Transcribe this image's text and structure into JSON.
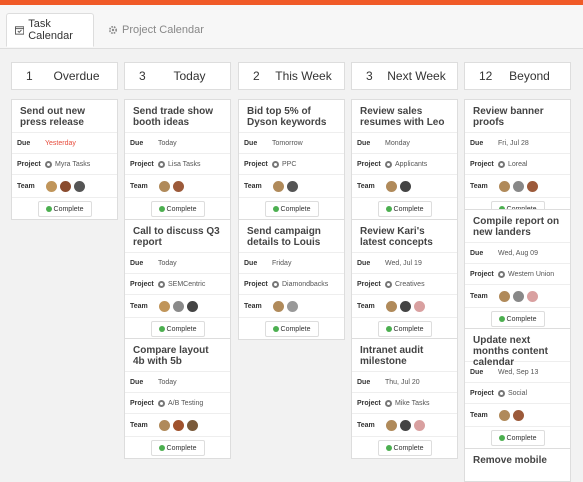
{
  "tabs": [
    {
      "label": "Task Calendar"
    },
    {
      "label": "Project Calendar"
    }
  ],
  "labels": {
    "due": "Due",
    "project": "Project",
    "team": "Team",
    "complete": "Complete"
  },
  "columns": [
    {
      "count": "1",
      "title": "Overdue"
    },
    {
      "count": "3",
      "title": "Today"
    },
    {
      "count": "2",
      "title": "This Week"
    },
    {
      "count": "3",
      "title": "Next Week"
    },
    {
      "count": "12",
      "title": "Beyond"
    }
  ],
  "cards": [
    {
      "title": "Send out new press release",
      "due": "Yesterday",
      "due_color": "#e74c3c",
      "project": "Myra Tasks",
      "team": [
        "#c0955a",
        "#8a4b2e",
        "#555555"
      ]
    },
    {
      "title": "Send trade show booth ideas",
      "due": "Today",
      "project": "Lisa Tasks",
      "team": [
        "#b08a5a",
        "#9c5a3a"
      ]
    },
    {
      "title": "Call to discuss Q3 report",
      "due": "Today",
      "project": "SEMCentric",
      "team": [
        "#c0955a",
        "#8a8a8a",
        "#444444"
      ]
    },
    {
      "title": "Compare layout 4b with 5b",
      "due": "Today",
      "project": "A/B Testing",
      "team": [
        "#b08a5a",
        "#a0522d",
        "#7a5a3a"
      ]
    },
    {
      "title": "Bid top 5% of Dyson keywords",
      "due": "Tomorrow",
      "project": "PPC",
      "team": [
        "#b08a5a",
        "#555555"
      ]
    },
    {
      "title": "Send campaign details to Louis",
      "due": "Friday",
      "project": "Diamondbacks",
      "team": [
        "#b08a5a",
        "#999999"
      ]
    },
    {
      "title": "Review sales resumes with Leo",
      "due": "Monday",
      "project": "Applicants",
      "team": [
        "#b08a5a",
        "#444444"
      ]
    },
    {
      "title": "Review Kari's latest concepts",
      "due": "Wed, Jul 19",
      "project": "Creatives",
      "team": [
        "#b08a5a",
        "#444444",
        "#d9a0a0"
      ]
    },
    {
      "title": "Intranet audit milestone",
      "due": "Thu, Jul 20",
      "project": "Mike Tasks",
      "team": [
        "#b08a5a",
        "#444444",
        "#d9a0a0"
      ]
    },
    {
      "title": "Review banner proofs",
      "due": "Fri, Jul 28",
      "project": "Loreal",
      "team": [
        "#b08a5a",
        "#888888",
        "#9c5a3a"
      ]
    },
    {
      "title": "Compile report on new landers",
      "due": "Wed, Aug 09",
      "project": "Western Union",
      "team": [
        "#b08a5a",
        "#888888",
        "#d9a0a0"
      ]
    },
    {
      "title": "Update next months content calendar",
      "due": "Wed, Sep 13",
      "project": "Social",
      "team": [
        "#b08a5a",
        "#9c5a3a"
      ]
    },
    {
      "title": "Remove mobile"
    }
  ],
  "colors": {
    "accent": "#f05a28",
    "complete": "#4caf50",
    "overdue": "#e74c3c"
  }
}
